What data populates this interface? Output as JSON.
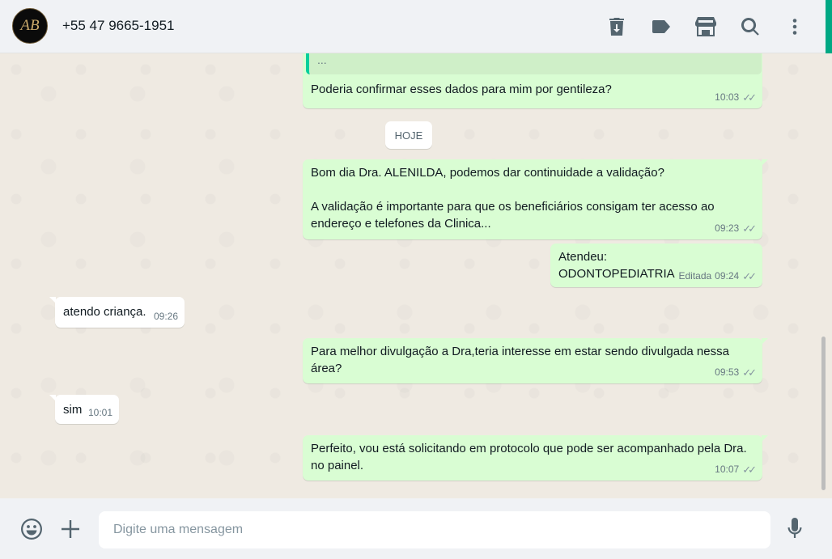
{
  "header": {
    "avatar_text": "AB",
    "contact_name": "+55 47 9665-1951",
    "icons": [
      "delete-icon",
      "label-icon",
      "store-icon",
      "search-icon",
      "menu-icon"
    ]
  },
  "chat": {
    "quoted_text": "...",
    "date_divider": "HOJE",
    "messages": [
      {
        "direction": "out",
        "text": "Poderia confirmar esses dados para mim por gentileza?",
        "time": "10:03",
        "status": "read"
      },
      {
        "direction": "out",
        "text": "Bom dia Dra. ALENILDA, podemos dar continuidade a validação?\n\nA validação é importante para que os beneficiários consigam ter acesso ao endereço e telefones da Clinica...",
        "time": "09:23",
        "status": "read"
      },
      {
        "direction": "out",
        "text": "Atendeu:\nODONTOPEDIATRIA",
        "edited_label": "Editada",
        "time": "09:24",
        "status": "read"
      },
      {
        "direction": "in",
        "text": "atendo criança.",
        "time": "09:26"
      },
      {
        "direction": "out",
        "text": "Para melhor divulgação a Dra,teria interesse em estar sendo divulgada nessa área?",
        "time": "09:53",
        "status": "read"
      },
      {
        "direction": "in",
        "text": "sim",
        "time": "10:01"
      },
      {
        "direction": "out",
        "text": "Perfeito, vou está solicitando em protocolo que pode ser acompanhado pela Dra. no painel.",
        "time": "10:07",
        "status": "read"
      }
    ]
  },
  "composer": {
    "placeholder": "Digite uma mensagem",
    "icons": [
      "emoji-icon",
      "attach-plus-icon",
      "microphone-icon"
    ]
  },
  "colors": {
    "outgoing_bubble": "#d9fdd3",
    "incoming_bubble": "#ffffff",
    "chat_background": "#efeae2",
    "header_background": "#f0f2f5",
    "accent": "#06cf9c"
  }
}
